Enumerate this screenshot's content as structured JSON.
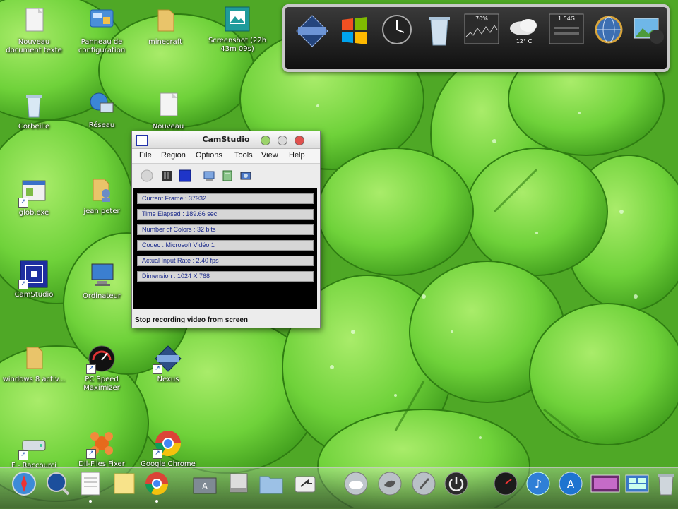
{
  "desktop": {
    "icons": [
      {
        "label": "Nouveau document texte",
        "icon": "text-document-icon"
      },
      {
        "label": "Panneau de configuration",
        "icon": "control-panel-icon"
      },
      {
        "label": "minecraft",
        "icon": "folder-icon"
      },
      {
        "label": "Screenshot (22h 43m 09s)",
        "icon": "image-file-icon"
      },
      {
        "label": "Corbeille",
        "icon": "recycle-bin-icon"
      },
      {
        "label": "Réseau",
        "icon": "network-icon"
      },
      {
        "label": "Nouveau",
        "icon": "text-document-icon"
      },
      {
        "label": "glob.exe",
        "icon": "application-icon"
      },
      {
        "label": "jean peter",
        "icon": "user-folder-icon"
      },
      {
        "label": "CamStudio",
        "icon": "camstudio-icon"
      },
      {
        "label": "Ordinateur",
        "icon": "computer-icon"
      },
      {
        "label": "windows 8 activ...",
        "icon": "folder-icon"
      },
      {
        "label": "PC Speed Maximizer",
        "icon": "speedometer-icon"
      },
      {
        "label": "Nexus",
        "icon": "nexus-icon"
      },
      {
        "label": "F - Raccourci",
        "icon": "drive-icon"
      },
      {
        "label": "Dll-Files Fixer",
        "icon": "dll-fixer-icon"
      },
      {
        "label": "Google Chrome",
        "icon": "chrome-icon"
      }
    ]
  },
  "gadgets": {
    "items": [
      {
        "name": "nexus-logo-icon"
      },
      {
        "name": "windows-logo-icon"
      },
      {
        "name": "clock-icon"
      },
      {
        "name": "recycle-bin-icon"
      },
      {
        "name": "cpu-meter-icon",
        "text": "70%"
      },
      {
        "name": "weather-icon",
        "text": "12° C"
      },
      {
        "name": "memory-meter-icon",
        "text": "1.54G"
      },
      {
        "name": "network-globe-icon"
      },
      {
        "name": "photo-camera-icon"
      }
    ]
  },
  "camstudio": {
    "title": "CamStudio",
    "menu": [
      "File",
      "Region",
      "Options",
      "Tools",
      "View",
      "Help"
    ],
    "info": [
      "Current Frame : 37932",
      "Time Elapsed : 189.66 sec",
      "Number of Colors : 32 bits",
      "Codec : Microsoft Vidéo 1",
      "Actual Input Rate : 2.40 fps",
      "Dimension : 1024 X 768"
    ],
    "status": "Stop recording video from screen",
    "colors": {
      "title_bg": "#e6e6e6",
      "info_bg": "#000000",
      "info_text": "#1b2a8a"
    }
  },
  "dock": {
    "items": [
      "safari-icon",
      "quicktime-icon",
      "textedit-icon",
      "notes-icon",
      "chrome-icon",
      "app-store-icon",
      "finder-drive-icon",
      "folder-icon",
      "share-icon",
      "cloud-icon",
      "twitter-bird-icon",
      "rocket-icon",
      "power-icon",
      "dashboard-icon",
      "itunes-icon",
      "appstore-a-icon",
      "photo-booth-icon",
      "window-manager-icon",
      "trash-icon"
    ]
  }
}
